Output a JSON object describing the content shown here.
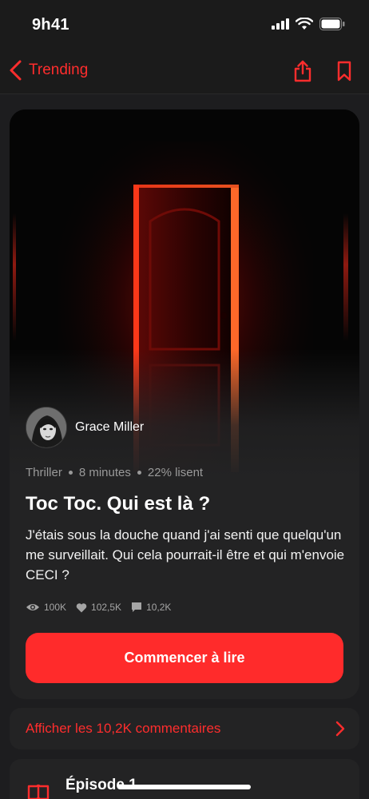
{
  "status_bar": {
    "time": "9h41"
  },
  "nav": {
    "back_label": "Trending",
    "icons": [
      "chevron-left-icon",
      "share-icon",
      "bookmark-icon"
    ]
  },
  "story": {
    "author": "Grace Miller",
    "genre": "Thriller",
    "duration": "8 minutes",
    "readers": "22% lisent",
    "title": "Toc Toc. Qui est là ?",
    "description": "J'étais sous la douche quand j'ai senti que quelqu'un me surveillait. Qui cela pourrait-il être et qui m'envoie CECI ?",
    "stats": {
      "views": "100K",
      "likes": "102,5K",
      "comments": "10,2K"
    },
    "cta_label": "Commencer à lire"
  },
  "comments_link": {
    "label": "Afficher les 10,2K commentaires"
  },
  "episode": {
    "title": "Épisode 1"
  },
  "colors": {
    "accent": "#ff2b2b",
    "background": "#1d1d1f",
    "card": "#232324"
  }
}
